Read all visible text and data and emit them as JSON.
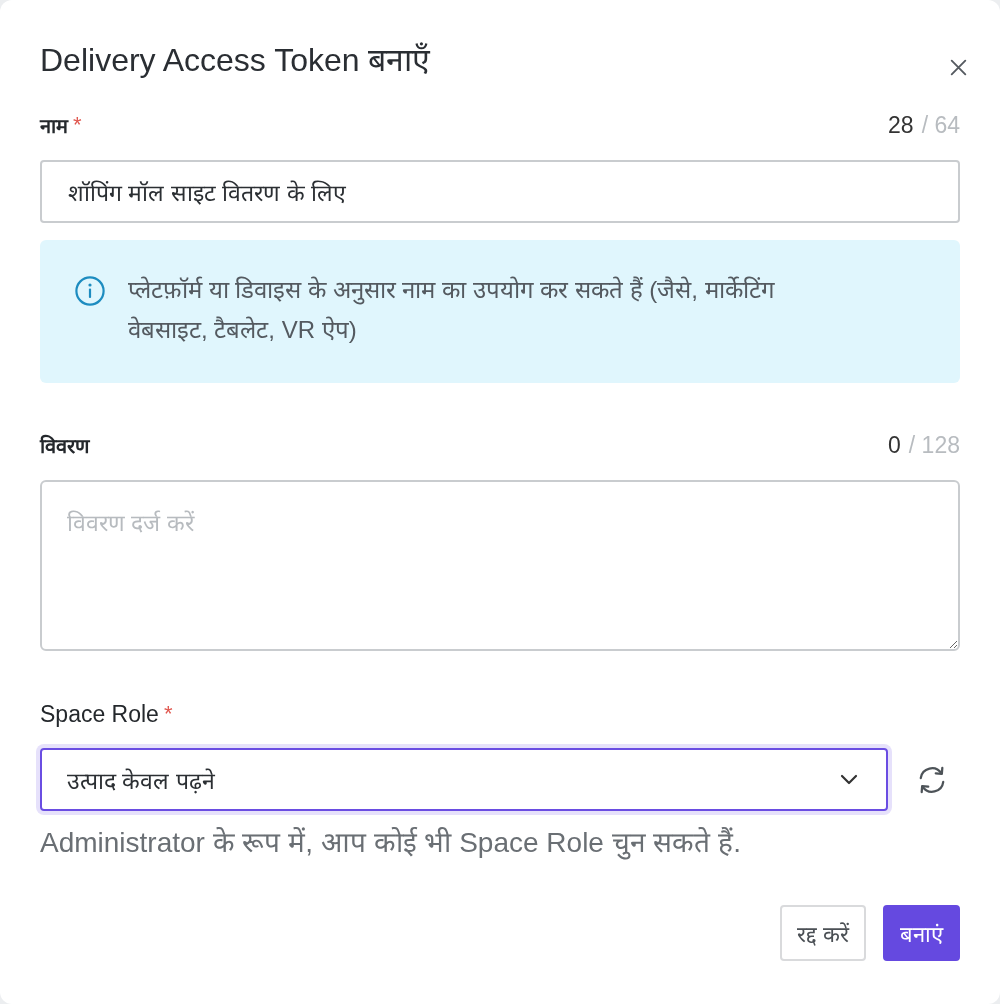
{
  "dialog": {
    "title": "Delivery Access Token बनाएँ"
  },
  "name_field": {
    "label": "नाम",
    "required_mark": "*",
    "count": "28",
    "limit": "/ 64",
    "value": "शॉपिंग मॉल साइट वितरण के लिए"
  },
  "info_note": {
    "text": "प्लेटफ़ॉर्म या डिवाइस के अनुसार नाम का उपयोग कर सकते हैं (जैसे, मार्केटिंग वेबसाइट, टैबलेट, VR ऐप)"
  },
  "description_field": {
    "label": "विवरण",
    "count": "0",
    "limit": "/ 128",
    "placeholder": "विवरण दर्ज करें"
  },
  "space_role_field": {
    "label": "Space Role",
    "required_mark": "*",
    "value": "उत्पाद केवल पढ़ने",
    "focused": true,
    "help": "Administrator के रूप में, आप कोई भी Space Role चुन सकते हैं."
  },
  "buttons": [
    {
      "label": "रद्द करें",
      "kind": "secondary"
    },
    {
      "label": "बनाएं",
      "kind": "primary"
    }
  ]
}
